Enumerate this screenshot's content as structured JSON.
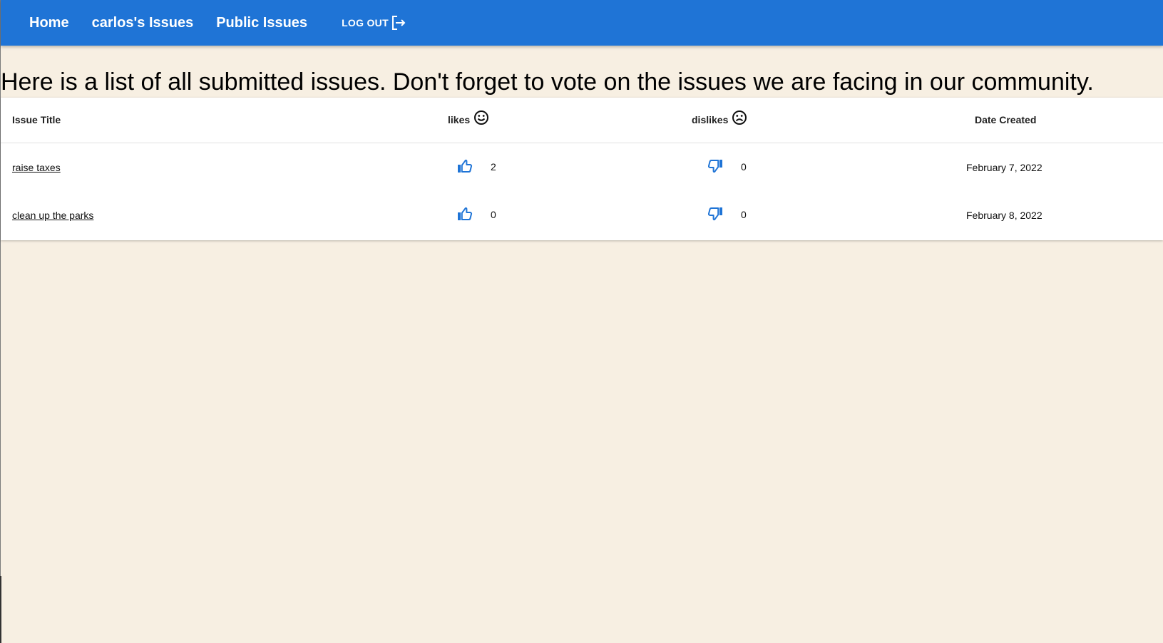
{
  "nav": {
    "home": "Home",
    "my_issues": "carlos's Issues",
    "public_issues": "Public Issues",
    "logout": "LOG OUT"
  },
  "intro": "Here is a list of all submitted issues. Don't forget to vote on the issues we are facing in our community.",
  "table": {
    "headers": {
      "title": "Issue Title",
      "likes": "likes",
      "dislikes": "dislikes",
      "date": "Date Created"
    },
    "rows": [
      {
        "title": "raise taxes",
        "likes": "2",
        "dislikes": "0",
        "date": "February 7, 2022"
      },
      {
        "title": "clean up the parks",
        "likes": "0",
        "dislikes": "0",
        "date": "February 8, 2022"
      }
    ]
  },
  "icons": {
    "logout": "logout-icon",
    "likes_header": "smiley-face-icon",
    "dislikes_header": "sad-face-icon",
    "like": "thumb-up-icon",
    "dislike": "thumb-down-icon"
  },
  "colors": {
    "navbar": "#1f74d6",
    "background": "#f7efe2",
    "vote_icon": "#1f74d6"
  }
}
